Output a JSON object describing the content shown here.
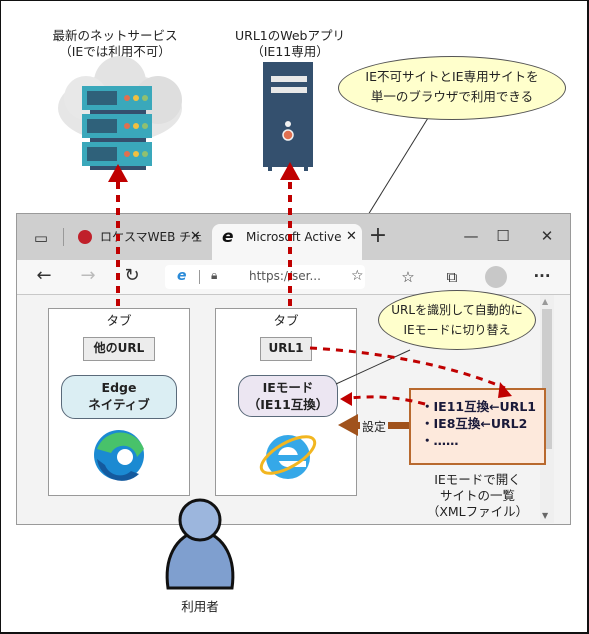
{
  "top_captions": {
    "modern_service": [
      "最新のネットサービス",
      "（IEでは利用不可）"
    ],
    "webapp": [
      "URL1のWebアプリ",
      "（IE11専用）"
    ]
  },
  "callouts": {
    "single_browser": [
      "IE不可サイトとIE専用サイトを",
      "単一のブラウザで利用できる"
    ],
    "auto_switch": [
      "URLを識別して自動的に",
      "IEモードに切り替え"
    ]
  },
  "browser": {
    "tabs": [
      {
        "label": "ロケスマWEB チェ",
        "icon": "logo-favicon-icon",
        "active": false
      },
      {
        "label": "Microsoft Active",
        "icon": "ie-icon",
        "active": true
      }
    ],
    "new_tab_icon": "+",
    "window_controls": {
      "minimize": "—",
      "maximize": "☐",
      "close": "✕"
    },
    "address": "https://ser...",
    "nav": {
      "back": "←",
      "forward": "→",
      "reload": "↻"
    },
    "toolbar_more": "···"
  },
  "panels": [
    {
      "tab_label": "タブ",
      "url": "他のURL",
      "mode": [
        "Edge",
        "ネイティブ"
      ],
      "mode_color": "#dbeef3",
      "engine_icon": "edge-logo-icon"
    },
    {
      "tab_label": "タブ",
      "url": "URL1",
      "mode": [
        "IEモード",
        "（IE11互換）"
      ],
      "mode_color": "#ece6f2",
      "engine_icon": "ie-logo-icon"
    }
  ],
  "site_list": {
    "items": [
      "・IE11互換←URL1",
      "・IE8互換←URL2",
      "・……"
    ],
    "caption": [
      "IEモードで開く",
      "サイトの一覧",
      "（XMLファイル）"
    ],
    "arrow_label": "設定"
  },
  "user_label": "利用者",
  "colors": {
    "dashed_arrow": "#c00000",
    "setting_arrow": "#a0521c",
    "callout_fill": "#ffffcc",
    "list_fill": "#fde9dc",
    "server_teal": "#3aa8bb",
    "tower_navy": "#34506e"
  }
}
